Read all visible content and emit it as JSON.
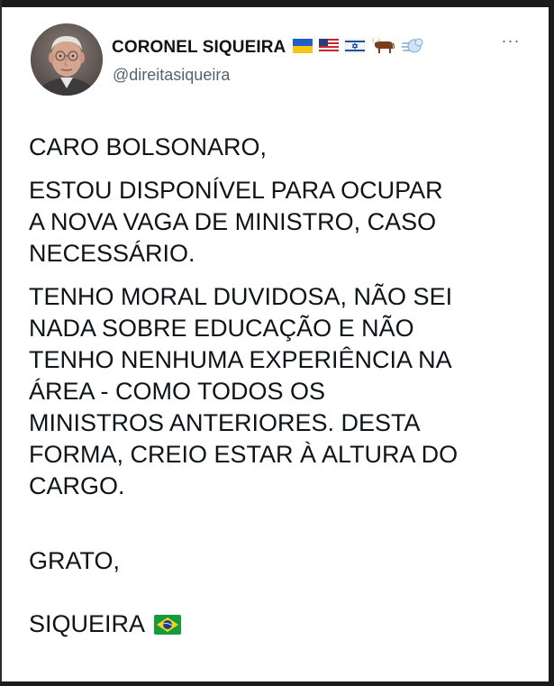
{
  "tweet": {
    "display_name": "CORONEL SIQUEIRA",
    "handle": "@direitasiqueira",
    "name_badges": [
      "ukraine-flag-icon",
      "usa-flag-icon",
      "israel-flag-icon",
      "ox-icon",
      "dash-away-icon"
    ],
    "more_label": "···",
    "paragraphs": [
      "CARO BOLSONARO,",
      "ESTOU DISPONÍVEL PARA OCUPAR\nA NOVA VAGA DE MINISTRO, CASO\nNECESSÁRIO.",
      "TENHO MORAL DUVIDOSA, NÃO SEI\nNADA SOBRE EDUCAÇÃO E NÃO\nTENHO NENHUMA EXPERIÊNCIA NA\nÁREA - COMO TODOS OS\nMINISTROS ANTERIORES. DESTA\nFORMA, CREIO ESTAR À ALTURA DO\nCARGO."
    ],
    "closing": "GRATO,",
    "signature": "SIQUEIRA",
    "signature_emoji": "brazil-flag-icon"
  },
  "colors": {
    "text_primary": "#0f1419",
    "text_secondary": "#536471",
    "frame": "#1b1b1b"
  }
}
